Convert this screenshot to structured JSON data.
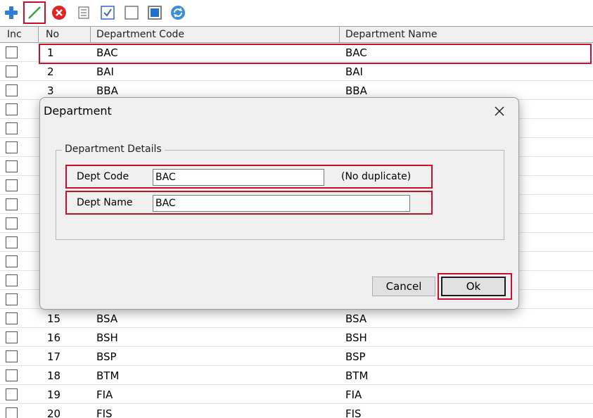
{
  "toolbar": {
    "icons": [
      "add-icon",
      "edit-icon",
      "delete-icon",
      "list-icon",
      "check-all-icon",
      "uncheck-all-icon",
      "stop-icon",
      "refresh-icon"
    ]
  },
  "grid": {
    "columns": {
      "inc": "Inc",
      "no": "No",
      "code": "Department Code",
      "name": "Department Name"
    },
    "rows": [
      {
        "no": "1",
        "code": "BAC",
        "name": "BAC"
      },
      {
        "no": "2",
        "code": "BAI",
        "name": "BAI"
      },
      {
        "no": "3",
        "code": "BBA",
        "name": "BBA"
      },
      {
        "no": "",
        "code": "",
        "name": ""
      },
      {
        "no": "",
        "code": "",
        "name": ""
      },
      {
        "no": "",
        "code": "",
        "name": ""
      },
      {
        "no": "",
        "code": "",
        "name": ""
      },
      {
        "no": "",
        "code": "",
        "name": ""
      },
      {
        "no": "",
        "code": "",
        "name": ""
      },
      {
        "no": "",
        "code": "",
        "name": ""
      },
      {
        "no": "",
        "code": "",
        "name": ""
      },
      {
        "no": "",
        "code": "",
        "name": ""
      },
      {
        "no": "",
        "code": "",
        "name": ""
      },
      {
        "no": "",
        "code": "",
        "name": ""
      },
      {
        "no": "15",
        "code": "BSA",
        "name": "BSA"
      },
      {
        "no": "16",
        "code": "BSH",
        "name": "BSH"
      },
      {
        "no": "17",
        "code": "BSP",
        "name": "BSP"
      },
      {
        "no": "18",
        "code": "BTM",
        "name": "BTM"
      },
      {
        "no": "19",
        "code": "FIA",
        "name": "FIA"
      },
      {
        "no": "20",
        "code": "FIS",
        "name": "FIS"
      }
    ]
  },
  "dialog": {
    "title": "Department",
    "group_label": "Department Details",
    "code_label": "Dept Code",
    "code_value": "BAC",
    "code_note": "(No duplicate)",
    "name_label": "Dept Name",
    "name_value": "BAC",
    "cancel_label": "Cancel",
    "ok_label": "Ok"
  },
  "colors": {
    "highlight": "#c8102e",
    "dialog_bg": "#f0f0f0"
  }
}
